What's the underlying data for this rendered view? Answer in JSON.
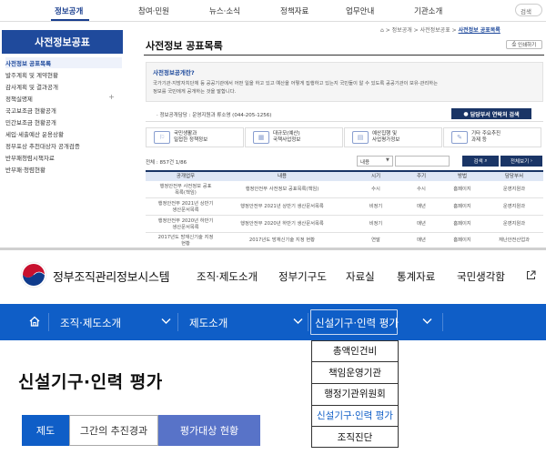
{
  "top": {
    "nav": [
      "정보공개",
      "참여·민원",
      "뉴스·소식",
      "정책자료",
      "업무안내",
      "기관소개"
    ],
    "search_placeholder": "검색",
    "sidebar_title": "사전정보공표",
    "sidebar_items": [
      "사전정보 공표목록",
      "발주계획 및 계약현황",
      "감사계획 및 결과공개",
      "정책실명제",
      "국고보조금 현황공개",
      "민간보조금 현황공개",
      "세입·세출예산 운용상황",
      "정부포상 추천대상자 공개검증",
      "반부패청렴시책자료",
      "반부패·청렴현황"
    ],
    "sidebar_plus": "+",
    "page_title": "사전정보 공표목록",
    "breadcrumb": [
      "⌂",
      "정보공개",
      "사전정보공표",
      "사전정보 공표목록"
    ],
    "print_label": "인쇄하기",
    "info_question": "사전정보공개란?",
    "info_desc1": "국가기관·지방자치단체 등 공공기관에서 어떤 일을 하고 있고 예산을 어떻게 집행하고 있는지 국민들이 알 수 있도록 공공기관이 보유·관리하는",
    "info_desc2": "정보를 국민에게 공개하는 것을 말합니다.",
    "contact": "· 정보공개담당 : 운영지원과 류소영 (044-205-1256)",
    "dept_button": "담당부서 연락처 검색",
    "categories": [
      {
        "icon": "⚐",
        "line1": "국민생활과",
        "line2": "밀접한 정책정보"
      },
      {
        "icon": "▦",
        "line1": "대규모(예산)",
        "line2": "국책사업정보"
      },
      {
        "icon": "▤",
        "line1": "예산집행 및",
        "line2": "사업평가정보"
      },
      {
        "icon": "✎",
        "line1": "기타 주요추진",
        "line2": "과제 등"
      }
    ],
    "total": "전체 : 857건 1/86",
    "search_select": "내용",
    "search_button": "검색",
    "viewall_button": "전체보기",
    "table_headers": [
      "공개업무",
      "내용",
      "시기",
      "주기",
      "방법",
      "담당부서"
    ],
    "rows": [
      {
        "task1": "행정안전부 사전정보 공표",
        "task2": "목록(책임)",
        "content": "행정안전부 사전정보 공표목록(책임)",
        "timing": "수시",
        "cycle": "수시",
        "method": "홈페이지",
        "dept": "운영지원과"
      },
      {
        "task1": "행정안전부 2021년 상반기",
        "task2": "생산문서목록",
        "content": "행정안전부 2021년 상반기 생산문서목록",
        "timing": "비정기",
        "cycle": "매년",
        "method": "홈페이지",
        "dept": "운영지원과"
      },
      {
        "task1": "행정안전부 2020년 하반기",
        "task2": "생산문서목록",
        "content": "행정안전부 2020년 하반기 생산문서목록",
        "timing": "비정기",
        "cycle": "매년",
        "method": "홈페이지",
        "dept": "운영지원과"
      },
      {
        "task1": "2017년도 방재신기술 지정",
        "task2": "현황",
        "content": "2017년도 방재신기술 지정 현황",
        "timing": "연말",
        "cycle": "매년",
        "method": "홈페이지",
        "dept": "재난안전산업과"
      }
    ]
  },
  "bottom": {
    "site_title": "정부조직관리정보시스템",
    "gnav": [
      "조직·제도소개",
      "정부기구도",
      "자료실",
      "통계자료",
      "국민생각함"
    ],
    "bar": [
      "조직·제도소개",
      "제도소개",
      "신설기구·인력 평가"
    ],
    "dropdown": [
      "총액인건비",
      "책임운영기관",
      "행정기관위원회",
      "신설기구·인력 평가",
      "조직진단"
    ],
    "main_title": "신설기구·인력 평가",
    "tabs": [
      "제도",
      "그간의 추진경과",
      "평가대상 현황"
    ],
    "colors": {
      "bar": "#0f5ec7",
      "tab_active": "#0f5ec7",
      "tab_third": "#5873c8"
    }
  }
}
